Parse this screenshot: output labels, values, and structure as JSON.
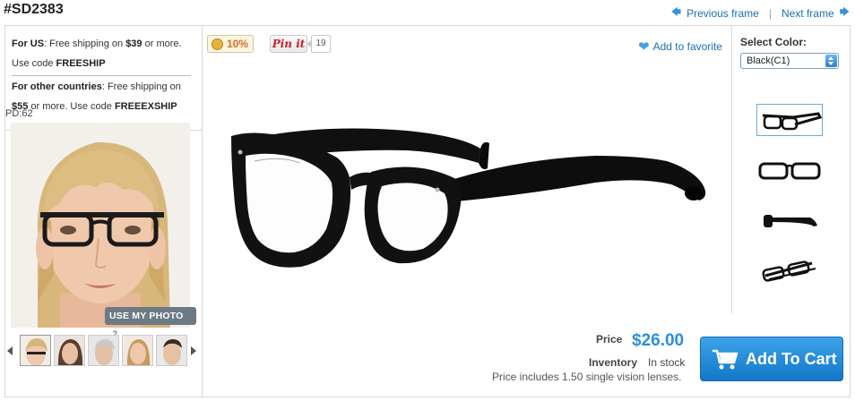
{
  "product": {
    "sku": "#SD2383"
  },
  "nav": {
    "previous": "Previous frame",
    "next": "Next frame"
  },
  "shipping": {
    "us_label": "For US",
    "us_text_a": ": Free shipping on ",
    "us_amount": "$39",
    "us_text_b": " or more.",
    "us_code_text": "Use code ",
    "us_code": "FREESHIP",
    "intl_label": "For other countries",
    "intl_text_a": ": Free shipping on",
    "intl_amount": "$55",
    "intl_text_b": " or more. Use code ",
    "intl_code": "FREEEXSHIP"
  },
  "tryon": {
    "pd": "PD:62",
    "use_photo": "USE MY PHOTO",
    "help_glyph": "?"
  },
  "social": {
    "discount": "10%",
    "pin_label": "Pin it",
    "pin_count": "19"
  },
  "favorite": {
    "label": "Add to favorite"
  },
  "color": {
    "label": "Select Color:",
    "selected": "Black(C1)"
  },
  "pricing": {
    "price_label": "Price",
    "price": "$26.00",
    "inventory_label": "Inventory",
    "inventory_status": "In stock",
    "note": "Price includes 1.50 single vision lenses."
  },
  "cart": {
    "label": "Add To Cart"
  },
  "colors": {
    "accent": "#2a8fdc",
    "link": "#1a6fb5",
    "cart_button": "#1f88d8",
    "discount": "#e06d17",
    "pinterest": "#cb2027"
  }
}
